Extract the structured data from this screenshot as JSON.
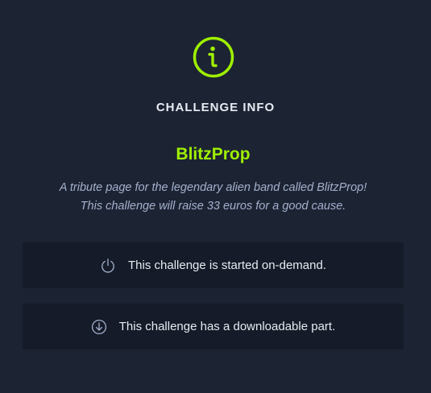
{
  "modal": {
    "title": "CHALLENGE INFO",
    "challenge_name": "BlitzProp",
    "description_line1": "A tribute page for the legendary alien band called BlitzProp!",
    "description_line2": "This challenge will raise 33 euros for a good cause."
  },
  "features": [
    {
      "icon": "power-icon",
      "text": "This challenge is started on-demand."
    },
    {
      "icon": "download-icon",
      "text": "This challenge has a downloadable part."
    }
  ],
  "colors": {
    "background": "#1c2333",
    "row_background": "#151b28",
    "accent": "#9fef00",
    "muted_text": "#a4b1cd",
    "text": "#e7ebf2"
  }
}
